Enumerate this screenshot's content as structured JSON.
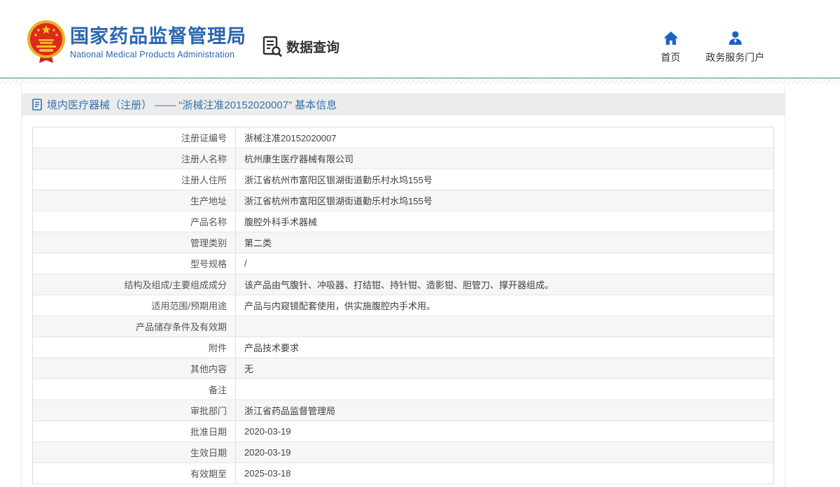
{
  "header": {
    "logo": {
      "title": "国家药品监督管理局",
      "subtitle": "National Medical Products Administration"
    },
    "data_query_label": "数据查询",
    "nav": [
      {
        "icon": "home-icon",
        "label": "首页"
      },
      {
        "icon": "user-icon",
        "label": "政务服务门户"
      }
    ]
  },
  "page": {
    "section_title": "境内医疗器械（注册） —— “浙械注准20152020007” 基本信息"
  },
  "table": {
    "rows": [
      {
        "label": "注册证编号",
        "value": "浙械注准20152020007"
      },
      {
        "label": "注册人名称",
        "value": "杭州康生医疗器械有限公司"
      },
      {
        "label": "注册人住所",
        "value": "浙江省杭州市富阳区银湖街道勤乐村水坞155号"
      },
      {
        "label": "生产地址",
        "value": "浙江省杭州市富阳区银湖街道勤乐村水坞155号"
      },
      {
        "label": "产品名称",
        "value": "腹腔外科手术器械"
      },
      {
        "label": "管理类别",
        "value": "第二类"
      },
      {
        "label": "型号规格",
        "value": "/"
      },
      {
        "label": "结构及组成/主要组成成分",
        "value": "该产品由气腹针、冲吸器、打结钳、持针钳、造影钳、胆管刀、撑开器组成。"
      },
      {
        "label": "适用范围/预期用途",
        "value": "产品与内窥镜配套使用，供实施腹腔内手术用。"
      },
      {
        "label": "产品储存条件及有效期",
        "value": ""
      },
      {
        "label": "附件",
        "value": "产品技术要求"
      },
      {
        "label": "其他内容",
        "value": "无"
      },
      {
        "label": "备注",
        "value": ""
      },
      {
        "label": "审批部门",
        "value": "浙江省药品监督管理局"
      },
      {
        "label": "批准日期",
        "value": "2020-03-19"
      },
      {
        "label": "生效日期",
        "value": "2020-03-19"
      },
      {
        "label": "有效期至",
        "value": "2025-03-18"
      }
    ]
  },
  "colors": {
    "brand_blue": "#2b66b0",
    "nav_icon_blue": "#1a64c0",
    "section_title_blue": "#3474ad",
    "separator_blue": "#4d7f94",
    "emblem_red": "#dd2a1b",
    "emblem_gold": "#f2c323"
  }
}
